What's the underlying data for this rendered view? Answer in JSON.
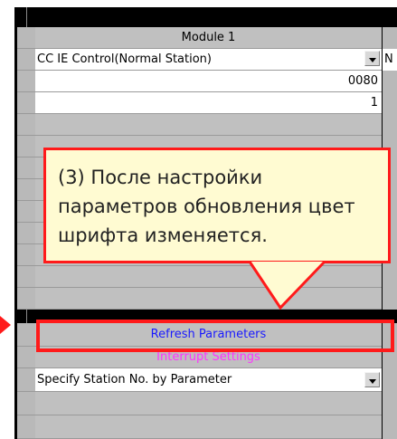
{
  "header": {
    "module_label": "Module 1",
    "next_col_glyph": "N"
  },
  "rows": {
    "network_type": {
      "value": "CC IE Control(Normal Station)"
    },
    "start_io": {
      "value": "0080"
    },
    "network_no": {
      "value": "1"
    },
    "refresh_params": {
      "label": "Refresh Parameters",
      "color": "#1a1aff"
    },
    "interrupt_settings": {
      "label": "Interrupt Settings",
      "color": "#ff33ff"
    },
    "station_no_method": {
      "value": "Specify Station No. by Parameter"
    }
  },
  "callout": {
    "text": "(3) После настройки параметров обновления цвет шрифта изменяется."
  },
  "colors": {
    "highlight": "#ff1a1a",
    "callout_bg": "#fffbd2"
  }
}
